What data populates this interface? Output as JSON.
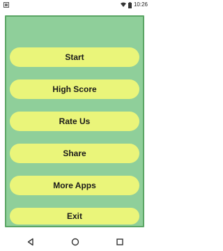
{
  "status_bar": {
    "time": "10:26",
    "icons": [
      "notification-icon",
      "wifi-icon",
      "battery-icon"
    ]
  },
  "menu": {
    "buttons": [
      {
        "label": "Start"
      },
      {
        "label": "High Score"
      },
      {
        "label": "Rate Us"
      },
      {
        "label": "Share"
      },
      {
        "label": "More Apps"
      },
      {
        "label": "Exit"
      }
    ]
  },
  "nav_bar": {
    "icons": [
      "back-icon",
      "home-icon",
      "recents-icon"
    ]
  },
  "colors": {
    "panel_background": "#8fcf9a",
    "panel_border": "#5aa564",
    "button_background": "#eaf57a"
  }
}
